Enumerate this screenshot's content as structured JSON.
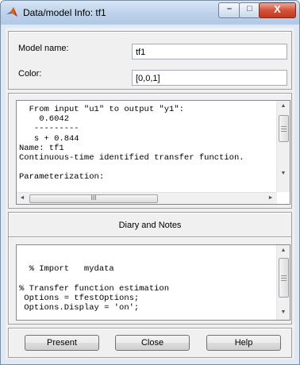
{
  "window": {
    "title": "Data/model Info: tf1",
    "controls": {
      "minimize": "–",
      "maximize": "□",
      "close": "X"
    }
  },
  "model": {
    "name_label": "Model name:",
    "name_value": "tf1",
    "color_label": "Color:",
    "color_value": "[0,0,1]"
  },
  "info_text": "  From input \"u1\" to output \"y1\":\n    0.6042\n   ---------\n   s + 0.844\nName: tf1\nContinuous-time identified transfer function.\n\nParameterization:",
  "diary": {
    "title": "Diary and Notes",
    "text": "\n\n  % Import   mydata\n\n% Transfer function estimation\n Options = tfestOptions;\n Options.Display = 'on';"
  },
  "scroll_glyphs": {
    "up": "▲",
    "down": "▼",
    "left": "◄",
    "right": "►",
    "thumb_grip": "III"
  },
  "buttons": {
    "present": "Present",
    "close": "Close",
    "help": "Help"
  },
  "colors": {
    "window_frame": "#bcd1ea",
    "close_button": "#c3381f",
    "panel_bg": "#f0f0f0"
  },
  "icons": {
    "app": "matlab-logo-icon"
  }
}
